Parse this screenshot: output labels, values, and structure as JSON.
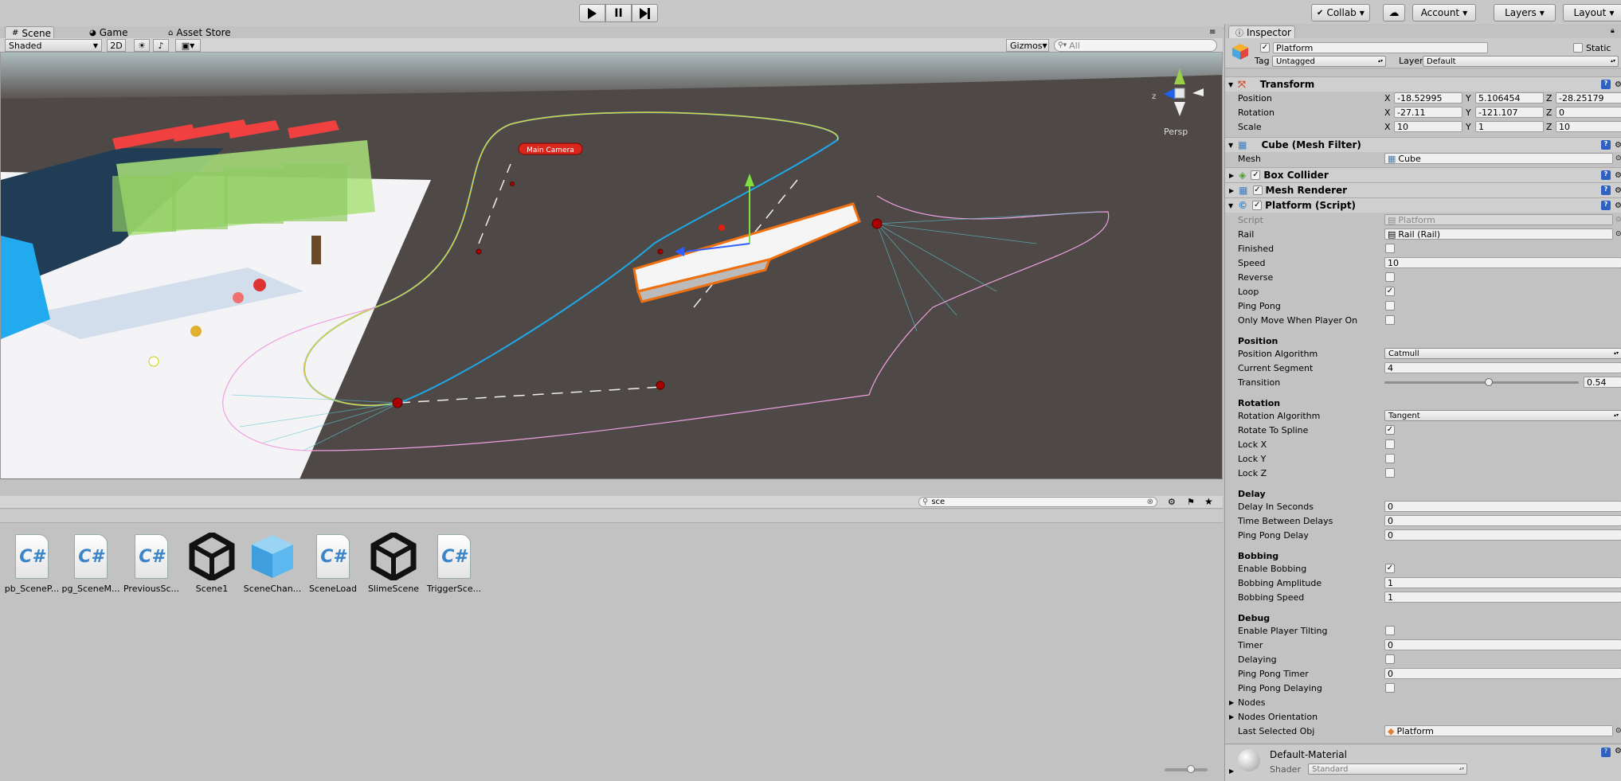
{
  "toolbar": {
    "collab": "Collab",
    "account": "Account",
    "layers": "Layers",
    "layout": "Layout"
  },
  "scene": {
    "tabs": [
      "Scene",
      "Game",
      "Asset Store"
    ],
    "shading": "Shaded",
    "mode_2d": "2D",
    "gizmos": "Gizmos",
    "search_placeholder": "All",
    "camera_label": "Main Camera",
    "persp": "Persp"
  },
  "project": {
    "search_value": "sce",
    "assets": [
      {
        "name": "pb_SceneP...",
        "type": "cs"
      },
      {
        "name": "pg_SceneM...",
        "type": "cs"
      },
      {
        "name": "PreviousSc...",
        "type": "cs"
      },
      {
        "name": "Scene1",
        "type": "unity"
      },
      {
        "name": "SceneChan...",
        "type": "cube"
      },
      {
        "name": "SceneLoad",
        "type": "cs"
      },
      {
        "name": "SlimeScene",
        "type": "unity"
      },
      {
        "name": "TriggerSce...",
        "type": "cs"
      }
    ]
  },
  "inspector": {
    "tab": "Inspector",
    "object_name": "Platform",
    "static_label": "Static",
    "tag_label": "Tag",
    "tag_value": "Untagged",
    "layer_label": "Layer",
    "layer_value": "Default",
    "transform": {
      "title": "Transform",
      "position_label": "Position",
      "rotation_label": "Rotation",
      "scale_label": "Scale",
      "position": [
        "-18.52995",
        "5.106454",
        "-28.25179"
      ],
      "rotation": [
        "-27.11",
        "-121.107",
        "0"
      ],
      "scale": [
        "10",
        "1",
        "10"
      ]
    },
    "mesh_filter": {
      "title": "Cube (Mesh Filter)",
      "mesh_label": "Mesh",
      "mesh_value": "Cube"
    },
    "box_collider": "Box Collider",
    "mesh_renderer": "Mesh Renderer",
    "script": {
      "title": "Platform (Script)",
      "script_label": "Script",
      "script_value": "Platform",
      "rail_label": "Rail",
      "rail_value": "Rail (Rail)",
      "finished": "Finished",
      "speed_label": "Speed",
      "speed": "10",
      "reverse": "Reverse",
      "loop": "Loop",
      "ping_pong": "Ping Pong",
      "only_move": "Only Move When Player On",
      "position_section": "Position",
      "position_algorithm_label": "Position Algorithm",
      "position_algorithm": "Catmull",
      "current_segment_label": "Current Segment",
      "current_segment": "4",
      "transition_label": "Transition",
      "transition": "0.54",
      "rotation_section": "Rotation",
      "rotation_algorithm_label": "Rotation Algorithm",
      "rotation_algorithm": "Tangent",
      "rotate_to_spline": "Rotate To Spline",
      "lock_x": "Lock X",
      "lock_y": "Lock Y",
      "lock_z": "Lock Z",
      "delay_section": "Delay",
      "delay_in_seconds_label": "Delay In Seconds",
      "delay_in_seconds": "0",
      "time_between_delays_label": "Time Between Delays",
      "time_between_delays": "0",
      "ping_pong_delay_label": "Ping Pong Delay",
      "ping_pong_delay": "0",
      "bobbing_section": "Bobbing",
      "enable_bobbing": "Enable Bobbing",
      "bobbing_amplitude_label": "Bobbing Amplitude",
      "bobbing_amplitude": "1",
      "bobbing_speed_label": "Bobbing Speed",
      "bobbing_speed": "1",
      "debug_section": "Debug",
      "enable_player_tilting": "Enable Player Tilting",
      "timer_label": "Timer",
      "timer": "0",
      "delaying": "Delaying",
      "ping_pong_timer_label": "Ping Pong Timer",
      "ping_pong_timer": "0",
      "ping_pong_delaying": "Ping Pong Delaying",
      "nodes": "Nodes",
      "nodes_orientation": "Nodes Orientation",
      "last_selected_label": "Last Selected Obj",
      "last_selected_value": "Platform"
    },
    "material": {
      "name": "Default-Material",
      "shader_label": "Shader",
      "shader_value": "Standard"
    }
  }
}
